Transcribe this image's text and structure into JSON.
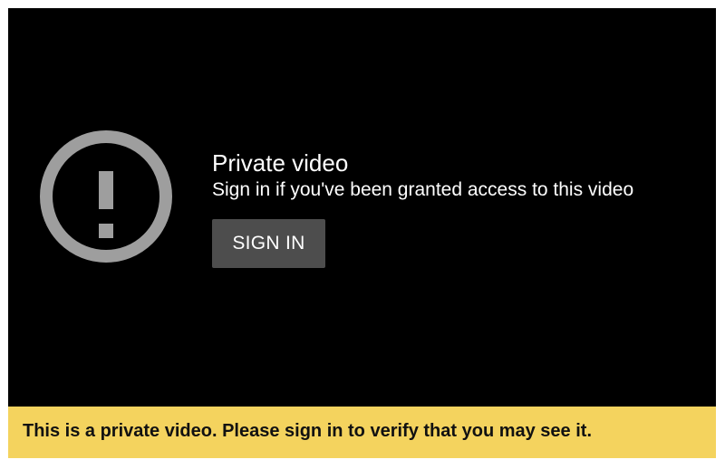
{
  "player": {
    "title": "Private video",
    "subtitle": "Sign in if you've been granted access to this video",
    "sign_in_label": "SIGN IN",
    "icon": "alert-circle-icon"
  },
  "notice": {
    "text": "This is a private video. Please sign in to verify that you may see it."
  },
  "colors": {
    "player_background": "#000000",
    "icon": "#9e9e9e",
    "button_background": "#4d4d4d",
    "notice_background": "#f4d35e"
  }
}
